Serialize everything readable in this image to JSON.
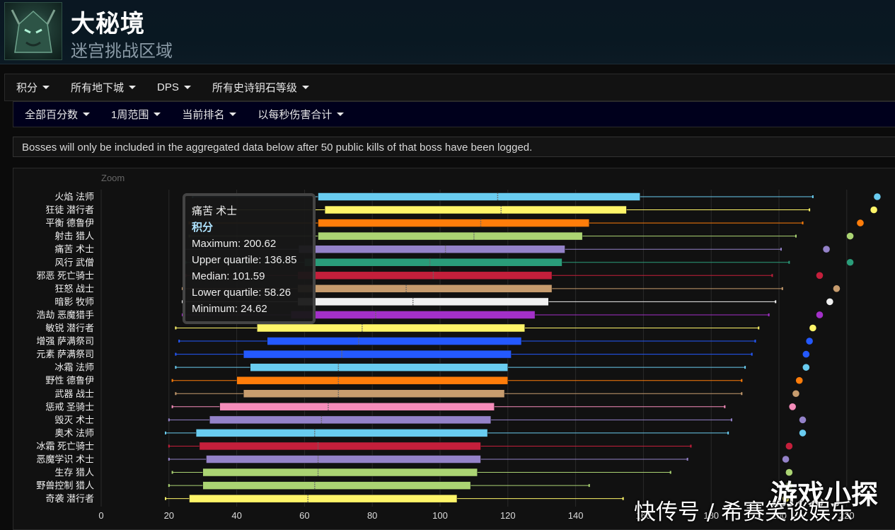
{
  "header": {
    "title": "大秘境",
    "subtitle": "迷宫挑战区域",
    "avatar_icon": "boss-portrait-icon"
  },
  "filters_primary": [
    {
      "label": "积分"
    },
    {
      "label": "所有地下城"
    },
    {
      "label": "DPS"
    },
    {
      "label": "所有史诗钥石等级"
    }
  ],
  "filters_secondary": [
    {
      "label": "全部百分数"
    },
    {
      "label": "1周范围"
    },
    {
      "label": "当前排名"
    },
    {
      "label": "以每秒伤害合计"
    }
  ],
  "notice": "Bosses will only be included in the aggregated data below after 50 public kills of that boss have been logged.",
  "chart_controls": {
    "zoom_label": "Zoom"
  },
  "tooltip": {
    "spec": "痛苦 术士",
    "metric": "积分",
    "maximum": "Maximum: 200.62",
    "upper_quartile": "Upper quartile: 136.85",
    "median": "Median: 101.59",
    "lower_quartile": "Lower quartile: 58.26",
    "minimum": "Minimum: 24.62"
  },
  "watermark": {
    "line1": "游戏小探",
    "line2": "快传号 / 希赛笑谈娱乐"
  },
  "chart_data": {
    "type": "boxplot",
    "orientation": "horizontal",
    "xlim": [
      0,
      230
    ],
    "x_ticks": [
      0,
      20,
      40,
      60,
      80,
      100,
      120,
      140,
      160,
      180,
      200,
      220
    ],
    "x_tick_labels": [
      "0",
      "20",
      "40",
      "60",
      "80",
      "100",
      "120",
      "140",
      "160",
      "180",
      "200",
      "220"
    ],
    "series": [
      {
        "label": "火焰 法师",
        "color": "#69ccf0",
        "min": 27,
        "q1": 64,
        "median": 117,
        "q3": 159,
        "max": 210,
        "point": 229
      },
      {
        "label": "狂徒 潜行者",
        "color": "#fff569",
        "min": 27,
        "q1": 66,
        "median": 118,
        "q3": 155,
        "max": 209,
        "point": 228
      },
      {
        "label": "平衡 德鲁伊",
        "color": "#ff7d0a",
        "min": 26,
        "q1": 64,
        "median": 112,
        "q3": 144,
        "max": 207,
        "point": 224
      },
      {
        "label": "射击 猎人",
        "color": "#abd473",
        "min": 26,
        "q1": 64,
        "median": 110,
        "q3": 142,
        "max": 205,
        "point": 221
      },
      {
        "label": "痛苦 术士",
        "color": "#9482c9",
        "min": 24.62,
        "q1": 58.26,
        "median": 101.59,
        "q3": 136.85,
        "max": 200.62,
        "point": 214
      },
      {
        "label": "风行 武僧",
        "color": "#2a9d7a",
        "min": 25,
        "q1": 60,
        "median": 97,
        "q3": 136,
        "max": 203,
        "point": 221
      },
      {
        "label": "邪恶 死亡骑士",
        "color": "#c41f3b",
        "min": 25,
        "q1": 58,
        "median": 98,
        "q3": 133,
        "max": 198,
        "point": 212
      },
      {
        "label": "狂怒 战士",
        "color": "#c79c6e",
        "min": 24,
        "q1": 58,
        "median": 90,
        "q3": 133,
        "max": 201,
        "point": 217
      },
      {
        "label": "暗影 牧师",
        "color": "#f0f0f0",
        "min": 24,
        "q1": 58,
        "median": 92,
        "q3": 132,
        "max": 199,
        "point": 215
      },
      {
        "label": "浩劫 恶魔猎手",
        "color": "#a330c9",
        "min": 24,
        "q1": 56,
        "median": 81,
        "q3": 128,
        "max": 197,
        "point": 212
      },
      {
        "label": "敏锐 潜行者",
        "color": "#fff569",
        "min": 22,
        "q1": 46,
        "median": 77,
        "q3": 125,
        "max": 194,
        "point": 210
      },
      {
        "label": "增强 萨满祭司",
        "color": "#2459ff",
        "min": 23,
        "q1": 49,
        "median": 76,
        "q3": 124,
        "max": 193,
        "point": 209
      },
      {
        "label": "元素 萨满祭司",
        "color": "#2459ff",
        "min": 22,
        "q1": 42,
        "median": 71,
        "q3": 121,
        "max": 192,
        "point": 208
      },
      {
        "label": "冰霜 法师",
        "color": "#69ccf0",
        "min": 22,
        "q1": 44,
        "median": 70,
        "q3": 120,
        "max": 190,
        "point": 208
      },
      {
        "label": "野性 德鲁伊",
        "color": "#ff7d0a",
        "min": 21,
        "q1": 40,
        "median": 70,
        "q3": 120,
        "max": 189,
        "point": 206
      },
      {
        "label": "武器 战士",
        "color": "#c79c6e",
        "min": 22,
        "q1": 42,
        "median": 70,
        "q3": 119,
        "max": 189,
        "point": 205
      },
      {
        "label": "惩戒 圣骑士",
        "color": "#f58cba",
        "min": 21,
        "q1": 35,
        "median": 67,
        "q3": 116,
        "max": 184,
        "point": 204
      },
      {
        "label": "毁灭 术士",
        "color": "#9482c9",
        "min": 20,
        "q1": 32,
        "median": 65,
        "q3": 115,
        "max": 186,
        "point": 207
      },
      {
        "label": "奥术 法师",
        "color": "#69ccf0",
        "min": 19,
        "q1": 28,
        "median": 63,
        "q3": 114,
        "max": 185,
        "point": 207
      },
      {
        "label": "冰霜 死亡骑士",
        "color": "#c41f3b",
        "min": 20,
        "q1": 29,
        "median": 64,
        "q3": 112,
        "max": 174,
        "point": 203
      },
      {
        "label": "恶魔学识 术士",
        "color": "#9482c9",
        "min": 20,
        "q1": 31,
        "median": 64,
        "q3": 112,
        "max": 173,
        "point": 202
      },
      {
        "label": "生存 猎人",
        "color": "#abd473",
        "min": 21,
        "q1": 30,
        "median": 64,
        "q3": 111,
        "max": 168,
        "point": 203
      },
      {
        "label": "野兽控制 猎人",
        "color": "#abd473",
        "min": 20,
        "q1": 30,
        "median": 63,
        "q3": 109,
        "max": 144,
        "point": 203
      },
      {
        "label": "奇袭 潜行者",
        "color": "#fff569",
        "min": 19,
        "q1": 26,
        "median": 61,
        "q3": 105,
        "max": 154,
        "point": 202
      }
    ]
  }
}
